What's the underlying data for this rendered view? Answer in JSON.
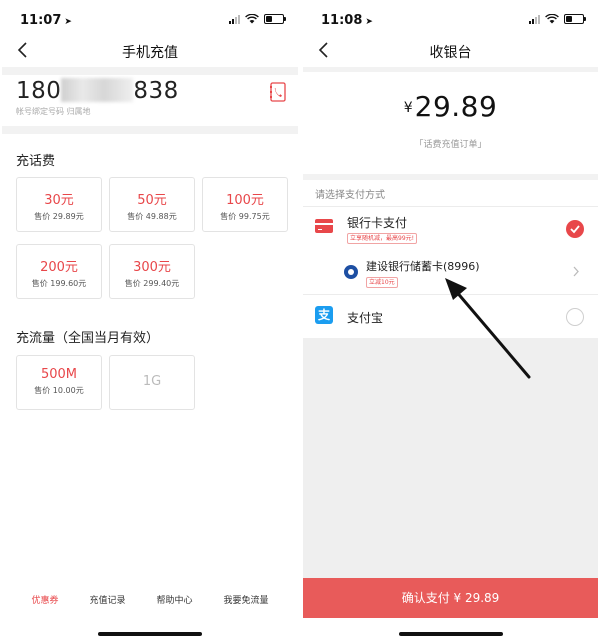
{
  "left": {
    "status": {
      "time": "11:07"
    },
    "nav": {
      "title": "手机充值"
    },
    "phone": {
      "prefix": "180",
      "suffix": "838",
      "hint": "帐号绑定号码 归属地"
    },
    "talk": {
      "title": "充话费",
      "options": [
        {
          "amount": "30元",
          "price": "售价 29.89元"
        },
        {
          "amount": "50元",
          "price": "售价 49.88元"
        },
        {
          "amount": "100元",
          "price": "售价 99.75元"
        },
        {
          "amount": "200元",
          "price": "售价 199.60元"
        },
        {
          "amount": "300元",
          "price": "售价 299.40元"
        }
      ]
    },
    "data_plan": {
      "title": "充流量（全国当月有效）",
      "options": [
        {
          "amount": "500M",
          "price": "售价 10.00元"
        },
        {
          "amount": "1G",
          "price": ""
        }
      ]
    },
    "footer": [
      "优惠券",
      "充值记录",
      "帮助中心",
      "我要免流量"
    ]
  },
  "right": {
    "status": {
      "time": "11:08"
    },
    "nav": {
      "title": "收银台"
    },
    "amount": {
      "currency": "¥",
      "value": "29.89"
    },
    "order_desc": "「话费充值订单」",
    "pay_label": "请选择支付方式",
    "methods": [
      {
        "name": "银行卡支付",
        "tag": "立享随机减，最高99元!"
      },
      {
        "name": "支付宝"
      }
    ],
    "bank_card": {
      "name": "建设银行储蓄卡(8996)",
      "tag": "立减10元"
    },
    "alipay_glyph": "支",
    "confirm": "确认支付 ¥ 29.89"
  },
  "colors": {
    "accent": "#e8474a",
    "confirm": "#e85b5a",
    "ccb": "#1d4fa3",
    "alipay": "#1b9df0"
  }
}
